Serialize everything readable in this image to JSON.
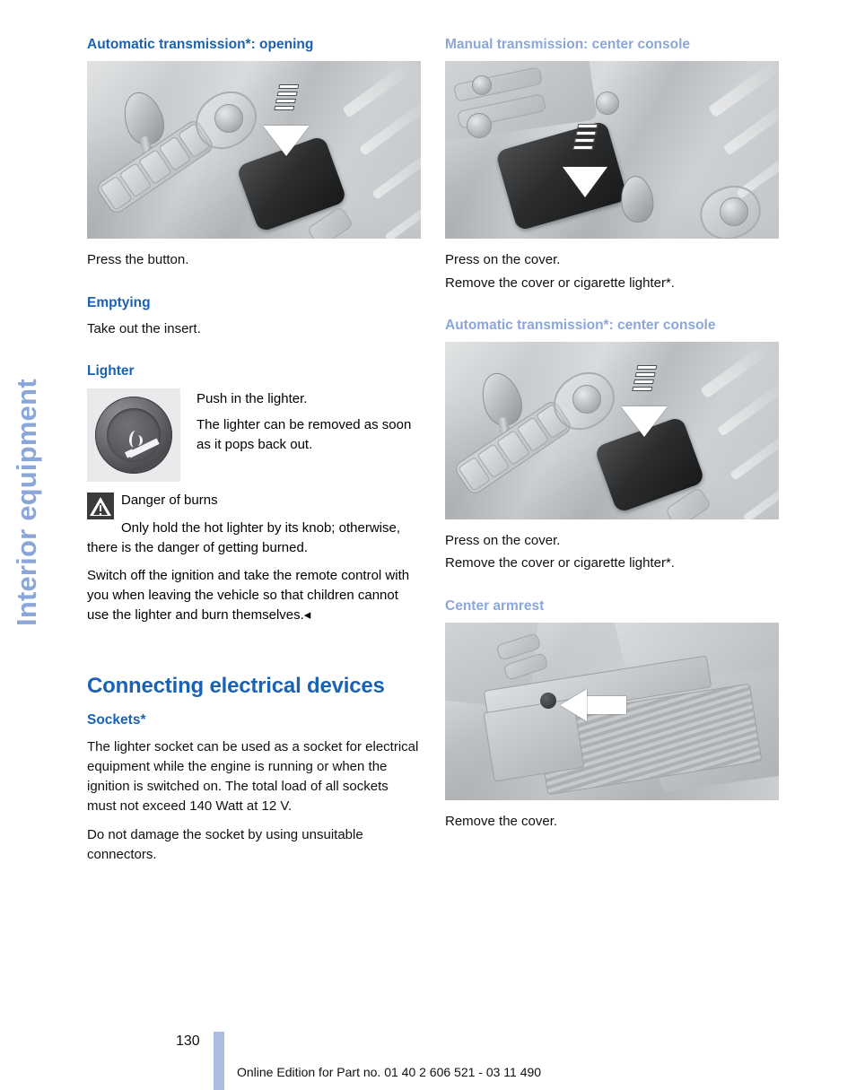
{
  "chapter_tab": {
    "label": "Interior equipment"
  },
  "left_column": {
    "section1": {
      "heading": "Automatic transmission*: opening",
      "figure_alt": "automatic-transmission-console-cover",
      "caption": "Press the button."
    },
    "section2": {
      "heading": "Emptying",
      "body": "Take out the insert."
    },
    "section3": {
      "heading": "Lighter",
      "figure_alt": "cigarette-lighter-knob",
      "line1": "Push in the lighter.",
      "line2": "The lighter can be removed as soon as it pops back out."
    },
    "warning": {
      "icon": "warning-triangle-icon",
      "title": "Danger of burns",
      "body": "Only hold the hot lighter by its knob; otherwise, there is the danger of getting burned.",
      "body2": "Switch off the ignition and take the remote control with you when leaving the vehicle so that children cannot use the lighter and burn themselves.◂"
    },
    "chapter": {
      "title": "Connecting electrical devices",
      "subheading": "Sockets*",
      "para1": "The lighter socket can be used as a socket for electrical equipment while the engine is running or when the ignition is switched on. The total load of all sockets must not exceed 140 Watt at 12 V.",
      "para2": "Do not damage the socket by using unsuitable connectors."
    }
  },
  "right_column": {
    "section1": {
      "heading": "Manual transmission: center console",
      "figure_alt": "manual-transmission-center-console",
      "caption1": "Press on the cover.",
      "caption2": "Remove the cover or cigarette lighter*."
    },
    "section2": {
      "heading": "Automatic transmission*: center console",
      "figure_alt": "automatic-transmission-center-console",
      "caption1": "Press on the cover.",
      "caption2": "Remove the cover or cigarette lighter*."
    },
    "section3": {
      "heading": "Center armrest",
      "figure_alt": "center-armrest-cover",
      "caption": "Remove the cover."
    }
  },
  "footer": {
    "page_number": "130",
    "note": "Online Edition for Part no. 01 40 2 606 521 - 03 11 490"
  },
  "colors": {
    "heading_blue": "#1a62b3",
    "muted_blue": "#8ba7da",
    "tab_blue": "#8ba7da",
    "footer_bar": "#aebce4",
    "figure_bg": "#c9ccce",
    "warn_icon_bg": "#3b3b3b"
  }
}
